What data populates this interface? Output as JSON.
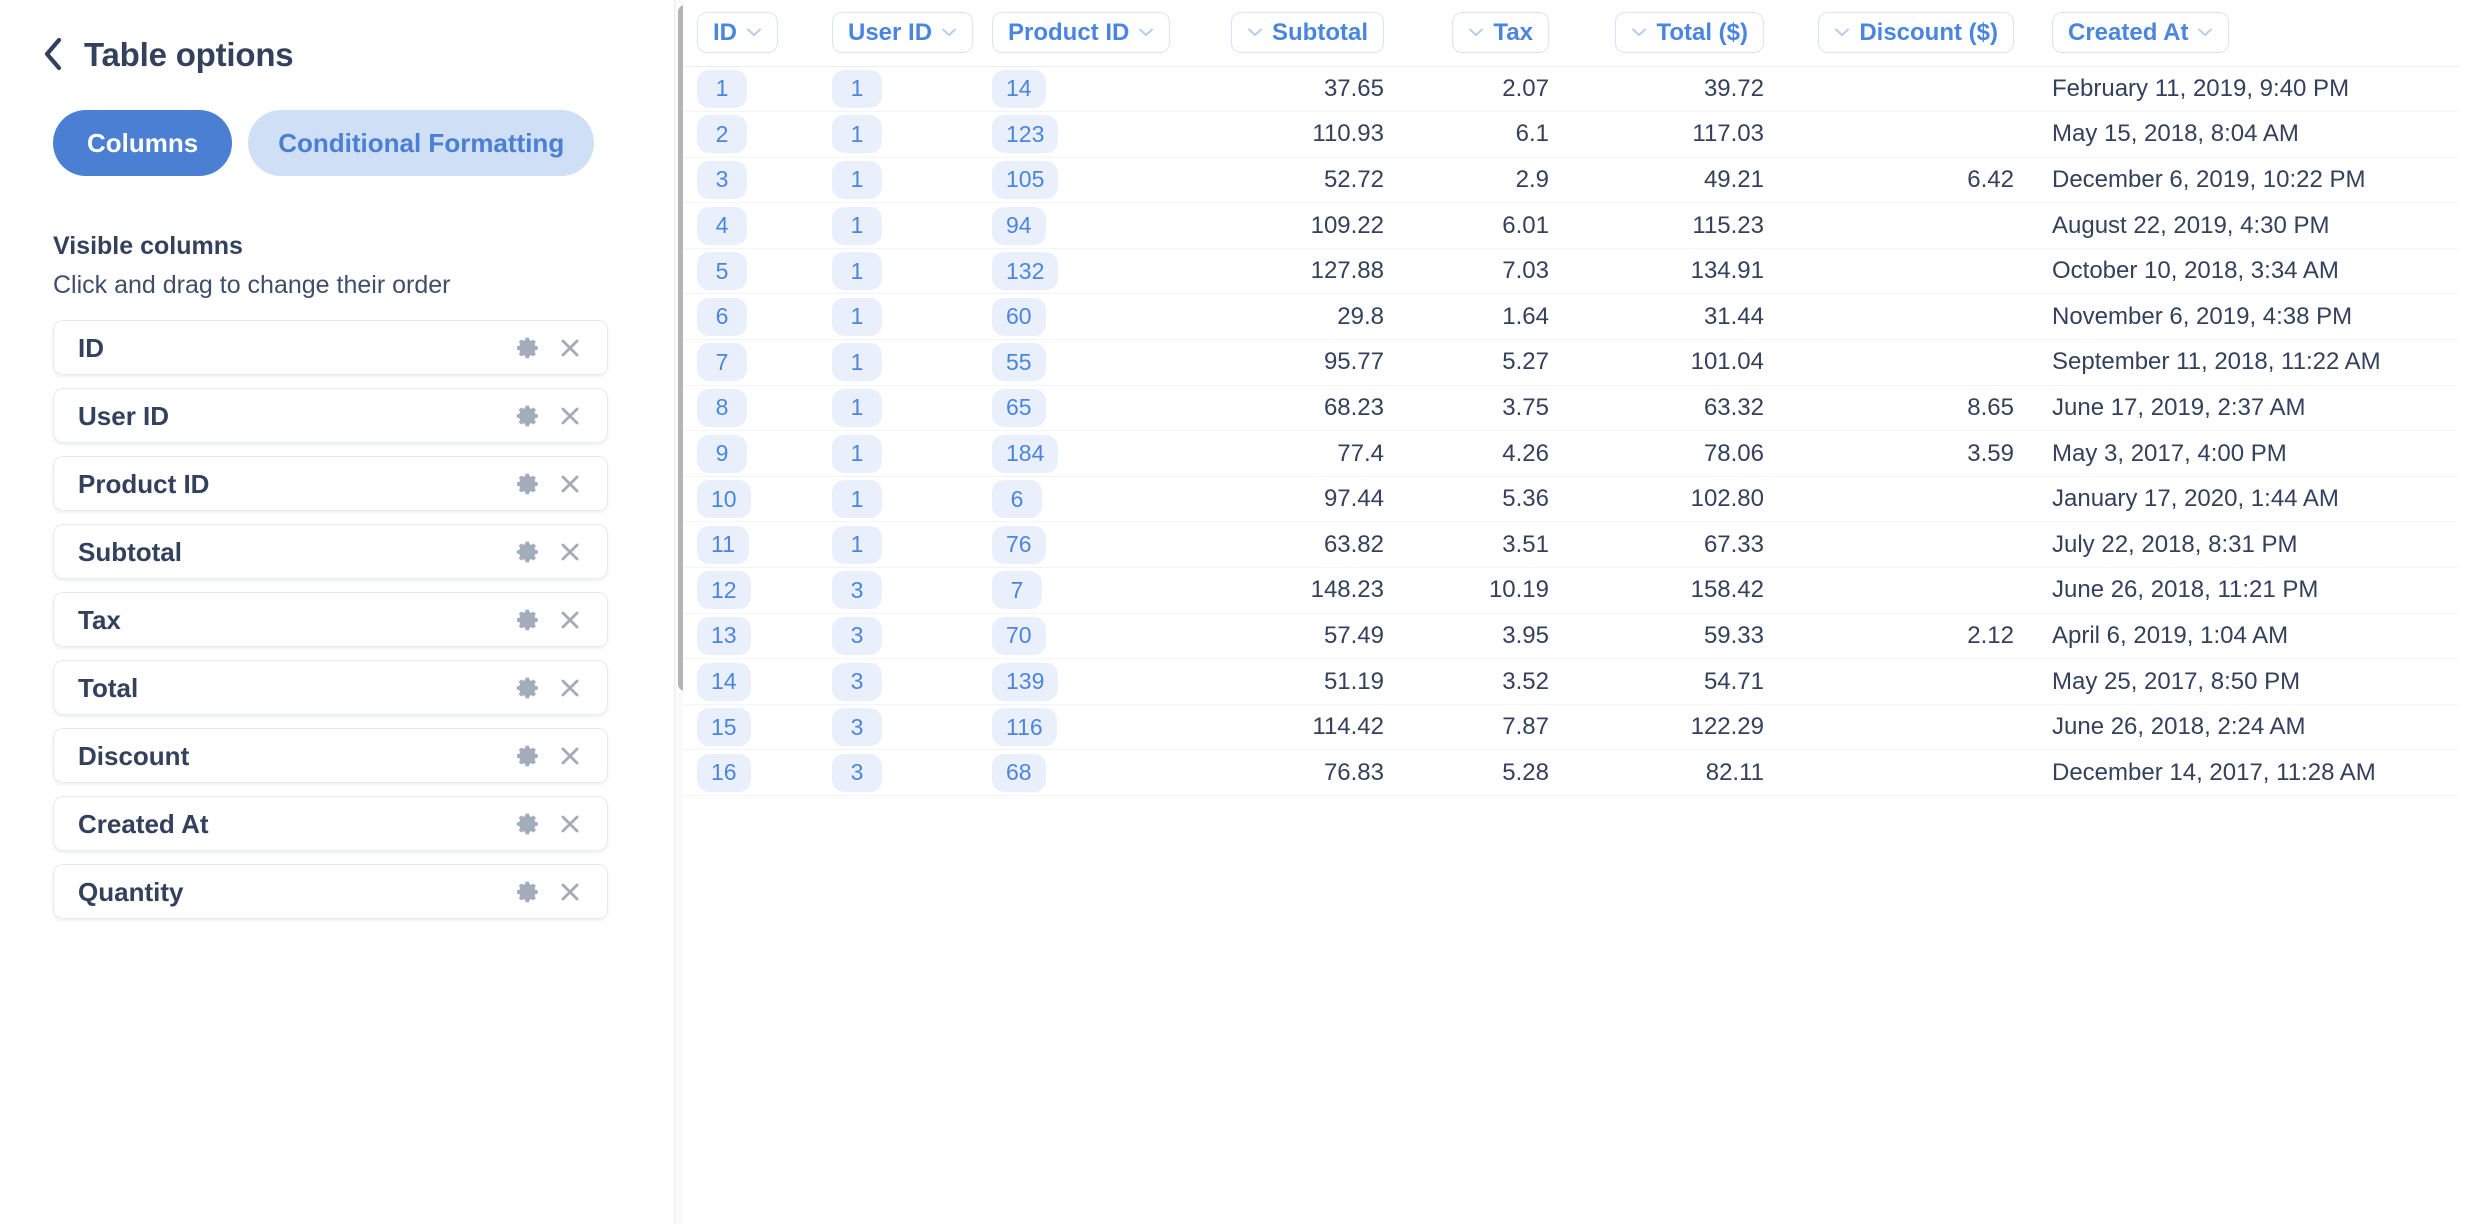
{
  "sidebar": {
    "back_icon": "chevron-left-icon",
    "title": "Table options",
    "tabs": [
      {
        "label": "Columns",
        "active": true
      },
      {
        "label": "Conditional Formatting",
        "active": false
      }
    ],
    "visible_columns_heading": "Visible columns",
    "visible_columns_hint": "Click and drag to change their order",
    "items": [
      {
        "label": "ID"
      },
      {
        "label": "User ID"
      },
      {
        "label": "Product ID"
      },
      {
        "label": "Subtotal"
      },
      {
        "label": "Tax"
      },
      {
        "label": "Total"
      },
      {
        "label": "Discount"
      },
      {
        "label": "Created At"
      },
      {
        "label": "Quantity"
      }
    ],
    "item_settings_icon": "gear-icon",
    "item_remove_icon": "close-icon"
  },
  "colors": {
    "accent": "#4a7fd4",
    "accent_light": "#cfdff5",
    "link": "#4a85df",
    "pill_bg": "#eaf0fb",
    "text": "#33415c",
    "border": "#d8e4f7"
  },
  "table": {
    "columns": [
      {
        "key": "id",
        "label": "ID",
        "align": "left",
        "chevron": "right",
        "cell_type": "pill"
      },
      {
        "key": "user_id",
        "label": "User ID",
        "align": "left",
        "chevron": "right",
        "cell_type": "pill"
      },
      {
        "key": "product_id",
        "label": "Product ID",
        "align": "left",
        "chevron": "right",
        "cell_type": "pill"
      },
      {
        "key": "subtotal",
        "label": "Subtotal",
        "align": "right",
        "chevron": "left",
        "cell_type": "num"
      },
      {
        "key": "tax",
        "label": "Tax",
        "align": "right",
        "chevron": "left",
        "cell_type": "num"
      },
      {
        "key": "total",
        "label": "Total ($)",
        "align": "right",
        "chevron": "left",
        "cell_type": "num"
      },
      {
        "key": "discount",
        "label": "Discount ($)",
        "align": "right",
        "chevron": "left",
        "cell_type": "num"
      },
      {
        "key": "created_at",
        "label": "Created At",
        "align": "left",
        "chevron": "right",
        "cell_type": "date"
      }
    ],
    "rows": [
      {
        "id": "1",
        "user_id": "1",
        "product_id": "14",
        "subtotal": "37.65",
        "tax": "2.07",
        "total": "39.72",
        "discount": "",
        "created_at": "February 11, 2019, 9:40 PM"
      },
      {
        "id": "2",
        "user_id": "1",
        "product_id": "123",
        "subtotal": "110.93",
        "tax": "6.1",
        "total": "117.03",
        "discount": "",
        "created_at": "May 15, 2018, 8:04 AM"
      },
      {
        "id": "3",
        "user_id": "1",
        "product_id": "105",
        "subtotal": "52.72",
        "tax": "2.9",
        "total": "49.21",
        "discount": "6.42",
        "created_at": "December 6, 2019, 10:22 PM"
      },
      {
        "id": "4",
        "user_id": "1",
        "product_id": "94",
        "subtotal": "109.22",
        "tax": "6.01",
        "total": "115.23",
        "discount": "",
        "created_at": "August 22, 2019, 4:30 PM"
      },
      {
        "id": "5",
        "user_id": "1",
        "product_id": "132",
        "subtotal": "127.88",
        "tax": "7.03",
        "total": "134.91",
        "discount": "",
        "created_at": "October 10, 2018, 3:34 AM"
      },
      {
        "id": "6",
        "user_id": "1",
        "product_id": "60",
        "subtotal": "29.8",
        "tax": "1.64",
        "total": "31.44",
        "discount": "",
        "created_at": "November 6, 2019, 4:38 PM"
      },
      {
        "id": "7",
        "user_id": "1",
        "product_id": "55",
        "subtotal": "95.77",
        "tax": "5.27",
        "total": "101.04",
        "discount": "",
        "created_at": "September 11, 2018, 11:22 AM"
      },
      {
        "id": "8",
        "user_id": "1",
        "product_id": "65",
        "subtotal": "68.23",
        "tax": "3.75",
        "total": "63.32",
        "discount": "8.65",
        "created_at": "June 17, 2019, 2:37 AM"
      },
      {
        "id": "9",
        "user_id": "1",
        "product_id": "184",
        "subtotal": "77.4",
        "tax": "4.26",
        "total": "78.06",
        "discount": "3.59",
        "created_at": "May 3, 2017, 4:00 PM"
      },
      {
        "id": "10",
        "user_id": "1",
        "product_id": "6",
        "subtotal": "97.44",
        "tax": "5.36",
        "total": "102.80",
        "discount": "",
        "created_at": "January 17, 2020, 1:44 AM"
      },
      {
        "id": "11",
        "user_id": "1",
        "product_id": "76",
        "subtotal": "63.82",
        "tax": "3.51",
        "total": "67.33",
        "discount": "",
        "created_at": "July 22, 2018, 8:31 PM"
      },
      {
        "id": "12",
        "user_id": "3",
        "product_id": "7",
        "subtotal": "148.23",
        "tax": "10.19",
        "total": "158.42",
        "discount": "",
        "created_at": "June 26, 2018, 11:21 PM"
      },
      {
        "id": "13",
        "user_id": "3",
        "product_id": "70",
        "subtotal": "57.49",
        "tax": "3.95",
        "total": "59.33",
        "discount": "2.12",
        "created_at": "April 6, 2019, 1:04 AM"
      },
      {
        "id": "14",
        "user_id": "3",
        "product_id": "139",
        "subtotal": "51.19",
        "tax": "3.52",
        "total": "54.71",
        "discount": "",
        "created_at": "May 25, 2017, 8:50 PM"
      },
      {
        "id": "15",
        "user_id": "3",
        "product_id": "116",
        "subtotal": "114.42",
        "tax": "7.87",
        "total": "122.29",
        "discount": "",
        "created_at": "June 26, 2018, 2:24 AM"
      },
      {
        "id": "16",
        "user_id": "3",
        "product_id": "68",
        "subtotal": "76.83",
        "tax": "5.28",
        "total": "82.11",
        "discount": "",
        "created_at": "December 14, 2017, 11:28 AM"
      }
    ]
  },
  "scrollbar": {
    "orientation": "vertical"
  }
}
